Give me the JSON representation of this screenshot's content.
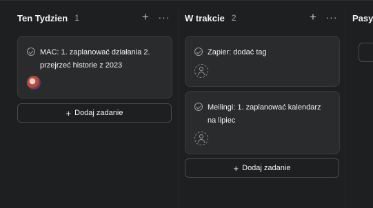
{
  "columns": [
    {
      "title": "Ten Tydzien",
      "count": "1",
      "add_icon": "plus-icon",
      "more_icon": "ellipsis-icon",
      "cards": [
        {
          "text": "MAC: 1. zaplanować działania 2. przejrzeć historie z 2023",
          "assignee": "avatar"
        }
      ],
      "add_label": "Dodaj zadanie"
    },
    {
      "title": "W trakcie",
      "count": "2",
      "add_icon": "plus-icon",
      "more_icon": "ellipsis-icon",
      "cards": [
        {
          "text": "Zapier: dodać tag",
          "assignee": "unassigned"
        },
        {
          "text": "Meilingi: 1. zaplanować kalendarz na lipiec",
          "assignee": "unassigned"
        }
      ],
      "add_label": "Dodaj zadanie"
    },
    {
      "title": "Pasyw"
    }
  ]
}
